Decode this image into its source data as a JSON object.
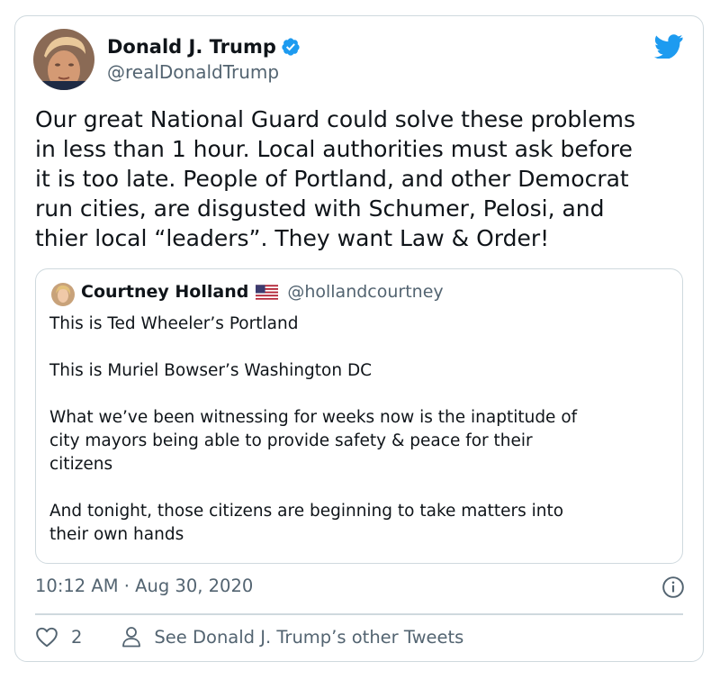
{
  "tweet": {
    "author_name": "Donald J. Trump",
    "author_handle": "@realDonaldTrump",
    "verified": true,
    "text": "Our great National Guard could solve these problems\nin less than 1 hour. Local authorities must ask before\nit is too late. People of Portland, and other Democrat\nrun cities, are disgusted with Schumer, Pelosi, and\nthier local “leaders”. They want Law & Order!",
    "timestamp": "10:12 AM · Aug 30, 2020",
    "like_count": "2",
    "see_other_label": "See Donald J. Trump’s other Tweets"
  },
  "quoted_tweet": {
    "author_name": "Courtney Holland",
    "author_handle": "@hollandcourtney",
    "flag": "us-flag-icon",
    "text": "This is Ted Wheeler’s Portland\n\nThis is Muriel Bowser’s Washington DC\n\nWhat we’ve been witnessing for weeks now is the inaptitude of\ncity mayors being able to provide safety & peace for their\ncitizens\n\nAnd tonight, those citizens are beginning to take matters into\ntheir own hands"
  },
  "icons": {
    "brand": "twitter-bird-icon",
    "verified": "verified-badge-icon",
    "info": "info-icon",
    "like": "heart-icon",
    "profile": "person-icon"
  },
  "colors": {
    "twitter_blue": "#1d9bf0",
    "text_primary": "#0f1419",
    "text_secondary": "#536471",
    "border": "#cfd9de"
  }
}
